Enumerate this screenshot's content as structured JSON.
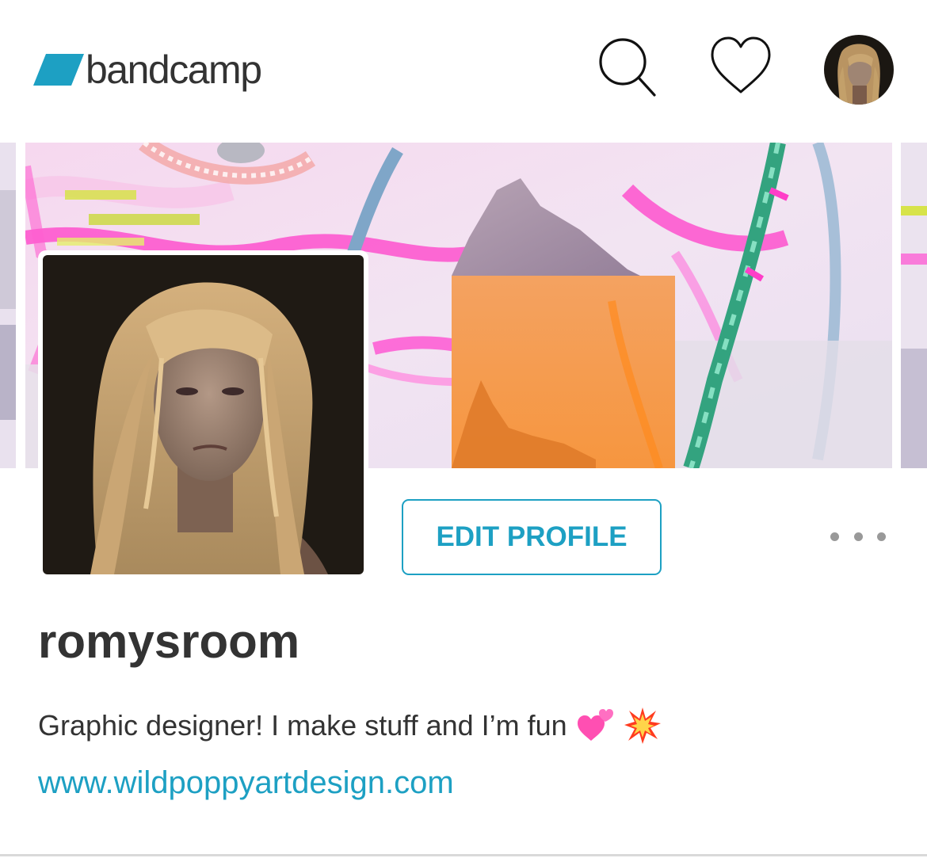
{
  "header": {
    "logo_text": "bandcamp",
    "logo_color": "#1da0c3",
    "search_icon": "search-icon",
    "heart_icon": "heart-icon",
    "avatar": "user-avatar"
  },
  "banner": {
    "image": "abstract-collage-cover",
    "palette": [
      "#f3d6f0",
      "#ff3ec8",
      "#f2a25c",
      "#3bb58e",
      "#a9b6d6"
    ]
  },
  "profile": {
    "edit_label": "EDIT PROFILE",
    "more_icon": "more-options-icon",
    "username": "romysroom",
    "bio": "Graphic designer! I make stuff and I’m fun",
    "bio_emojis": [
      "two-hearts-emoji",
      "collision-emoji"
    ],
    "website": "www.wildpoppyartdesign.com",
    "accent_color": "#1da0c3"
  }
}
